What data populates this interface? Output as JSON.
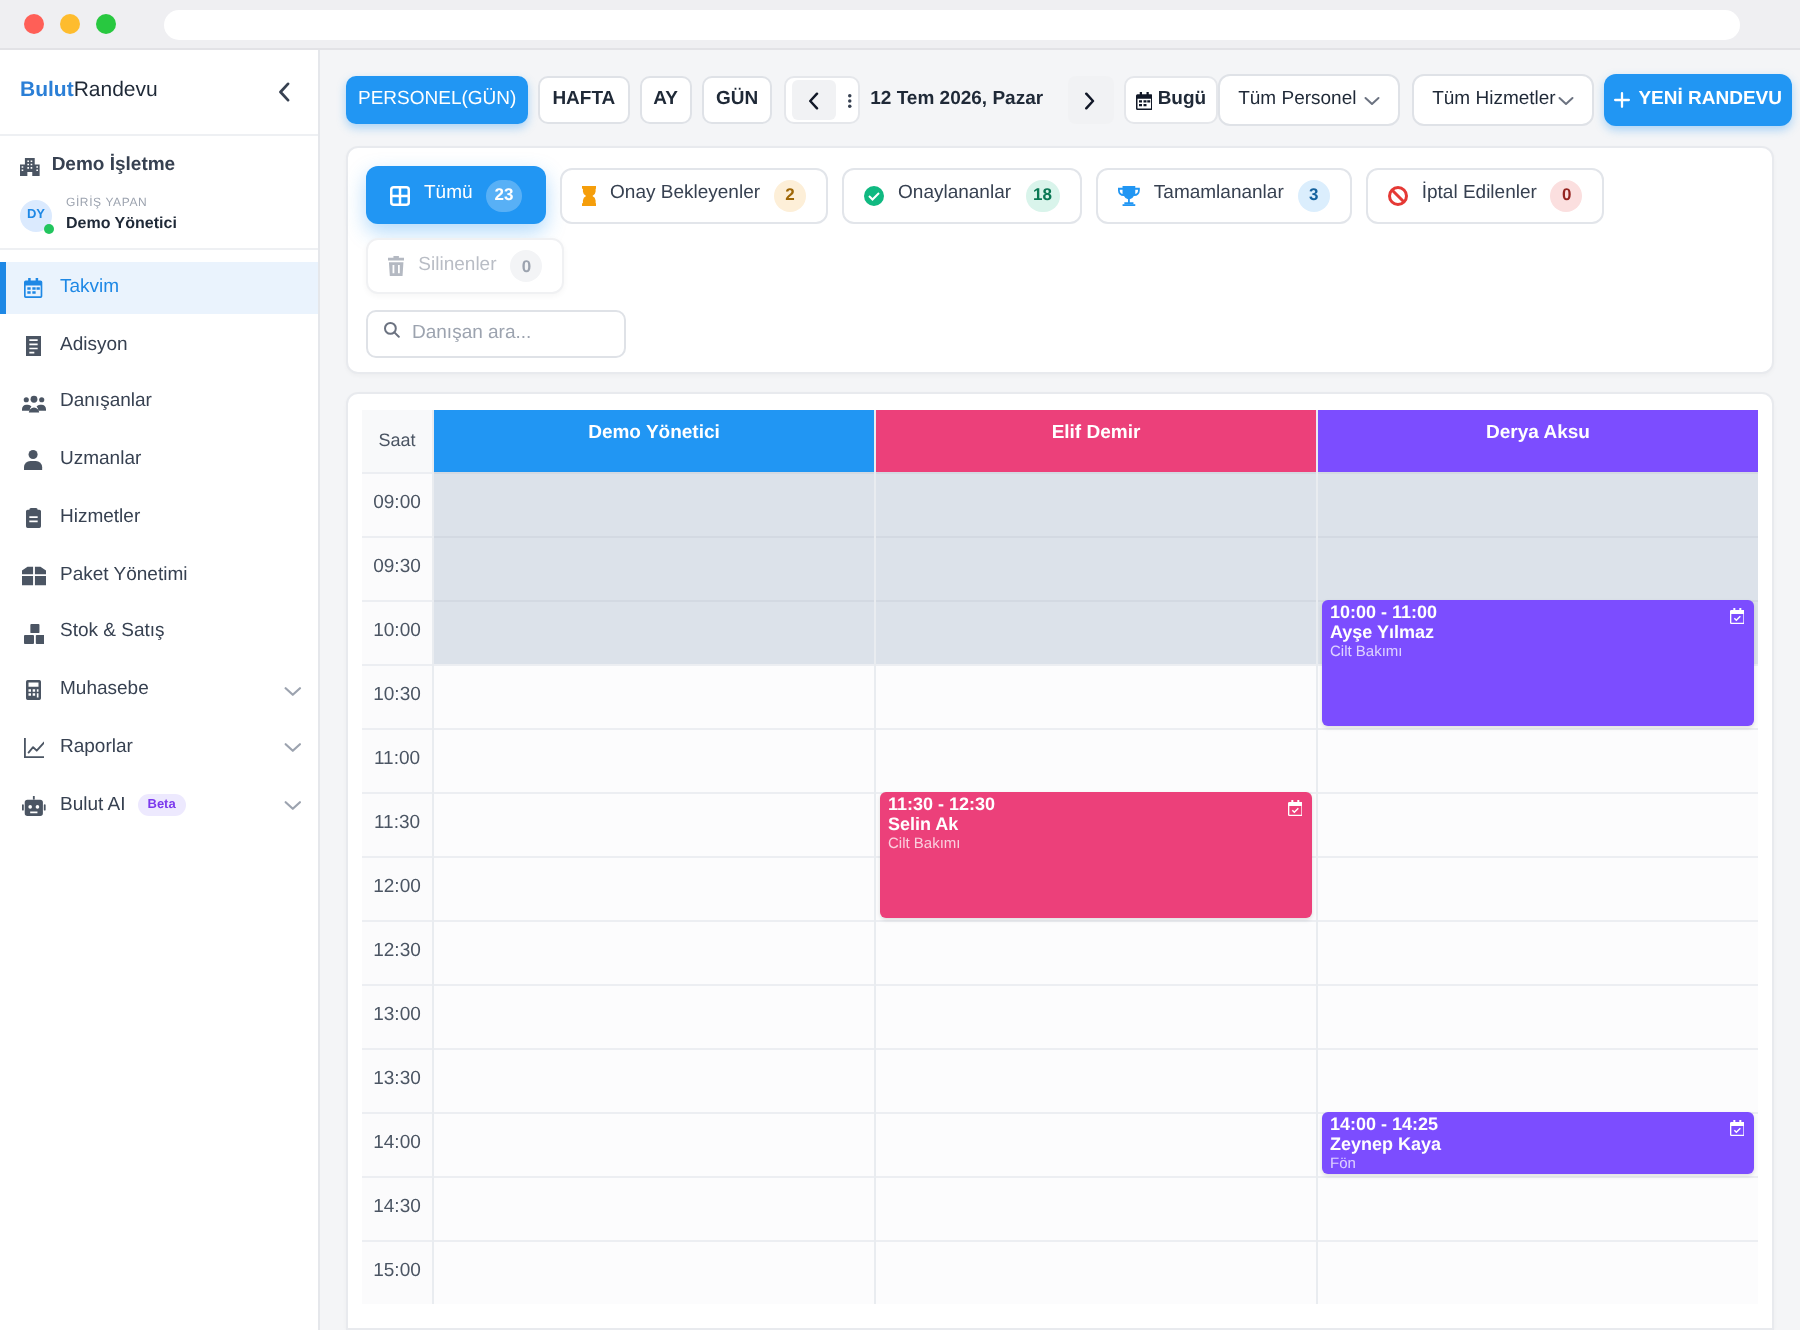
{
  "sidebar": {
    "logo": {
      "brand": "Bulut",
      "product": "Randevu"
    },
    "business": "Demo İşletme",
    "user": {
      "initials": "DY",
      "online": true,
      "caption": "GİRİŞ YAPAN",
      "name": "Demo Yönetici"
    },
    "items": [
      {
        "label": "Takvim",
        "kind": "link",
        "selected": true
      },
      {
        "label": "Adisyon",
        "kind": "link",
        "selected": false
      },
      {
        "label": "Danışanlar",
        "kind": "link",
        "selected": false
      },
      {
        "label": "Uzmanlar",
        "kind": "link",
        "selected": false
      },
      {
        "label": "Hizmetler",
        "kind": "link",
        "selected": false
      },
      {
        "label": "Paket Yönetimi",
        "kind": "link",
        "selected": false
      },
      {
        "label": "Stok & Satış",
        "kind": "link",
        "selected": false
      },
      {
        "label": "Muhasebe",
        "kind": "group",
        "selected": false,
        "expanded": false
      },
      {
        "label": "Raporlar",
        "kind": "group",
        "selected": false,
        "expanded": false
      },
      {
        "label": "Bulut AI",
        "kind": "group",
        "selected": false,
        "expanded": false,
        "badge": "Beta"
      }
    ]
  },
  "toolbar": {
    "views": [
      {
        "label": "PERSONEL(GÜN)",
        "selected": true
      },
      {
        "label": "HAFTA",
        "selected": false
      },
      {
        "label": "AY",
        "selected": false
      },
      {
        "label": "GÜN",
        "selected": false
      }
    ],
    "date": "12 Tem 2026, Pazar",
    "today_button": "Bugü",
    "dropdowns": [
      {
        "value": "Tüm Personel"
      },
      {
        "value": "Tüm Hizmetler"
      }
    ],
    "new_button": "YENİ RANDEVU"
  },
  "status_tabs": [
    {
      "label": "Tümü",
      "count": "23",
      "color": "#2196f3",
      "selected": true,
      "disabled": false
    },
    {
      "label": "Onay Bekleyenler",
      "count": "2",
      "color": "#f59e0b",
      "selected": false,
      "disabled": false
    },
    {
      "label": "Onaylananlar",
      "count": "18",
      "color": "#10b981",
      "selected": false,
      "disabled": false
    },
    {
      "label": "Tamamlananlar",
      "count": "3",
      "color": "#2196f3",
      "selected": false,
      "disabled": false
    },
    {
      "label": "İptal Edilenler",
      "count": "0",
      "color": "#e53935",
      "selected": false,
      "disabled": false
    },
    {
      "label": "Silinenler",
      "count": "0",
      "color": "#b4b9c2",
      "selected": false,
      "disabled": true
    }
  ],
  "search": {
    "placeholder": "Danışan ara..."
  },
  "calendar": {
    "time_header": "Saat",
    "slots": [
      {
        "time": "09:00",
        "unavailable": true
      },
      {
        "time": "09:30",
        "unavailable": true
      },
      {
        "time": "10:00",
        "unavailable": true
      },
      {
        "time": "10:30",
        "unavailable": false
      },
      {
        "time": "11:00",
        "unavailable": false
      },
      {
        "time": "11:30",
        "unavailable": false
      },
      {
        "time": "12:00",
        "unavailable": false
      },
      {
        "time": "12:30",
        "unavailable": false
      },
      {
        "time": "13:00",
        "unavailable": false
      },
      {
        "time": "13:30",
        "unavailable": false
      },
      {
        "time": "14:00",
        "unavailable": false
      },
      {
        "time": "14:30",
        "unavailable": false
      },
      {
        "time": "15:00",
        "unavailable": false
      }
    ],
    "columns": [
      {
        "name": "Demo Yönetici",
        "color": "#2196f3"
      },
      {
        "name": "Elif Demir",
        "color": "#ec407a",
        "events": [
          {
            "time": "11:30 - 12:30",
            "client": "Selin Ak",
            "service": "Cilt Bakımı"
          }
        ]
      },
      {
        "name": "Derya Aksu",
        "color": "#7c4dff",
        "events": [
          {
            "time": "10:00 - 11:00",
            "client": "Ayşe Yılmaz",
            "service": "Cilt Bakımı"
          },
          {
            "time": "14:00 - 14:25",
            "client": "Zeynep Kaya",
            "service": "Fön"
          }
        ]
      }
    ]
  }
}
